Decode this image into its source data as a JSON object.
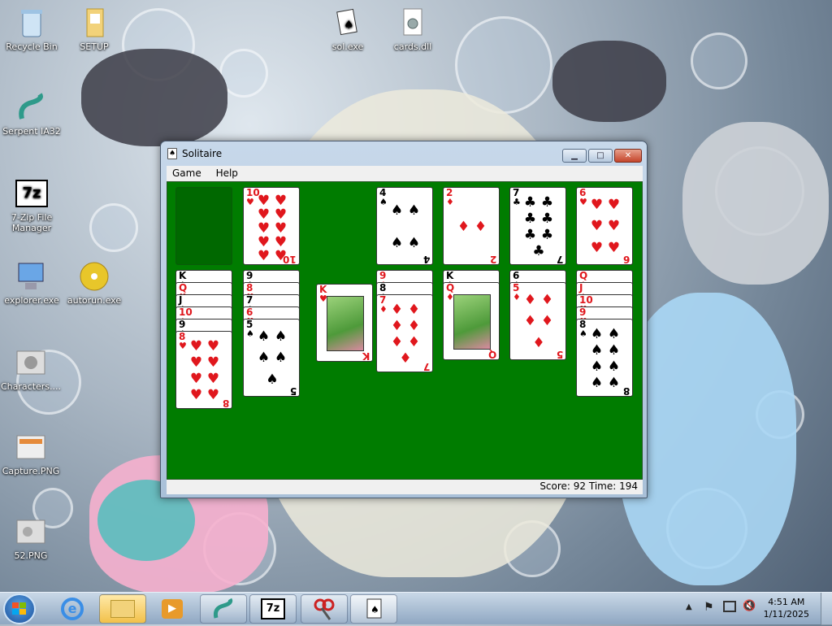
{
  "desktop_icons": [
    {
      "label": "Recycle Bin",
      "icon": "recycle-bin-icon"
    },
    {
      "label": "SETUP",
      "icon": "folder-icon"
    },
    {
      "label": "sol.exe",
      "icon": "solitaire-exe-icon"
    },
    {
      "label": "cards.dll",
      "icon": "dll-file-icon"
    },
    {
      "label": "Serpent IA32",
      "icon": "serpent-icon"
    },
    {
      "label": "7-Zip File Manager",
      "icon": "7zip-icon"
    },
    {
      "label": "explorer.exe",
      "icon": "explorer-exe-icon"
    },
    {
      "label": "autorun.exe",
      "icon": "cd-icon"
    },
    {
      "label": "Characters....",
      "icon": "image-file-icon"
    },
    {
      "label": "Capture.PNG",
      "icon": "png-file-icon"
    },
    {
      "label": "52.PNG",
      "icon": "png-file-icon"
    }
  ],
  "window": {
    "title": "Solitaire",
    "minimize_label": "▁",
    "maximize_label": "□",
    "close_label": "✕",
    "menu": [
      "Game",
      "Help"
    ],
    "status": "Score: 92 Time: 194"
  },
  "game": {
    "foundations": [
      {
        "rank": "4",
        "suit": "♠",
        "color": "black"
      },
      {
        "rank": "2",
        "suit": "♦",
        "color": "red"
      },
      {
        "rank": "7",
        "suit": "♣",
        "color": "black"
      },
      {
        "rank": "6",
        "suit": "♥",
        "color": "red"
      }
    ],
    "waste_card": {
      "rank": "10",
      "suit": "♥",
      "color": "red"
    },
    "tableau": [
      [
        "K",
        "Q",
        "J",
        "10",
        "9",
        "8"
      ],
      [
        "9",
        "8",
        "7",
        "6",
        "5"
      ],
      [
        "K"
      ],
      [
        "9",
        "8",
        "7"
      ],
      [
        "K",
        "Q"
      ],
      [
        "6",
        "5"
      ],
      [
        "Q",
        "J",
        "10",
        "9",
        "8"
      ]
    ],
    "tableau_suits": [
      [
        "♠",
        "♥",
        "♠",
        "♦",
        "♠",
        "♥"
      ],
      [
        "♠",
        "♥",
        "♠",
        "♥",
        "♠"
      ],
      [
        "♥"
      ],
      [
        "♦",
        "♠",
        "♦"
      ],
      [
        "♠",
        "♦"
      ],
      [
        "♠",
        "♦"
      ],
      [
        "♦",
        "♦",
        "♥",
        "♥",
        "♠"
      ]
    ]
  },
  "taskbar": {
    "clock_time": "4:51 AM",
    "clock_date": "1/11/2025",
    "buttons": [
      "internet-explorer-icon",
      "file-explorer-icon",
      "media-player-icon",
      "serpent-icon",
      "7zip-icon",
      "snipping-tool-icon",
      "solitaire-icon"
    ]
  },
  "colors": {
    "felt": "#007c00",
    "red_suit": "#e0171d",
    "taskbar": "#a9bfd6"
  }
}
